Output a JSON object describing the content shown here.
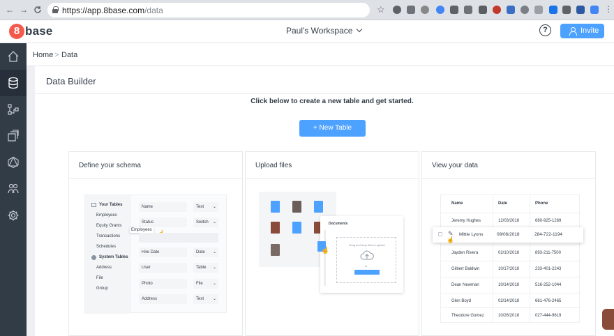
{
  "browser": {
    "url_host": "https://app.8base.com",
    "url_path": "/data",
    "back_glyph": "←",
    "forward_glyph": "→",
    "reload_glyph": "C"
  },
  "header": {
    "logo_digit": "8",
    "logo_word": "base",
    "workspace": "Paul's Workspace",
    "help": "?",
    "invite": "Invite"
  },
  "sidebar": {
    "items": [
      {
        "icon": "home-icon"
      },
      {
        "icon": "database-icon"
      },
      {
        "icon": "flow-icon"
      },
      {
        "icon": "cube-icon"
      },
      {
        "icon": "graph-icon"
      },
      {
        "icon": "team-icon"
      },
      {
        "icon": "gear-icon"
      }
    ]
  },
  "breadcrumb": {
    "home": "Home",
    "sep": ">",
    "current": "Data"
  },
  "main": {
    "title": "Data Builder",
    "cta": "Click below to create a new table and get started.",
    "new_table": "+ New Table",
    "panels": [
      {
        "title": "Define your schema"
      },
      {
        "title": "Upload files"
      },
      {
        "title": "View your data"
      }
    ]
  },
  "schema": {
    "your_tables_label": "Your Tables",
    "your_tables": [
      "Employees",
      "Equity Grants",
      "Transactions",
      "Schedules"
    ],
    "system_tables_label": "System Tables",
    "system_tables": [
      "Address",
      "File",
      "Group"
    ],
    "drag_ghost": "Employees",
    "fields": [
      {
        "name": "Name",
        "type": "Text"
      },
      {
        "name": "Status",
        "type": "Switch"
      },
      {
        "name": "Hire Date",
        "type": "Date"
      },
      {
        "name": "User",
        "type": "Table"
      },
      {
        "name": "Photo",
        "type": "File"
      },
      {
        "name": "Address",
        "type": "Text"
      }
    ]
  },
  "upload": {
    "documents_label": "Documents",
    "drop_text": "Drag and drop files to upload",
    "or_text": "or"
  },
  "view": {
    "headers": [
      "Name",
      "Date",
      "Phone"
    ],
    "rows": [
      [
        "Jeremy Hughes",
        "12/03/2018",
        "660-925-1269"
      ],
      [
        "Mittie Lyons",
        "09/06/2018",
        "284-722-1194"
      ],
      [
        "Jayden Rivera",
        "02/10/2018",
        "893-211-7500"
      ],
      [
        "Gilbert Baldwin",
        "10/17/2018",
        "233-401-2243"
      ],
      [
        "Dean Newman",
        "10/14/2018",
        "516-252-1044"
      ],
      [
        "Glen Boyd",
        "02/14/2018",
        "661-476-2465"
      ],
      [
        "Theodore Gomez",
        "10/26/2018",
        "027-444-9619"
      ]
    ]
  },
  "colors": {
    "accent": "#4da1ff",
    "sidebar": "#323c47",
    "logo": "#f5594b"
  }
}
